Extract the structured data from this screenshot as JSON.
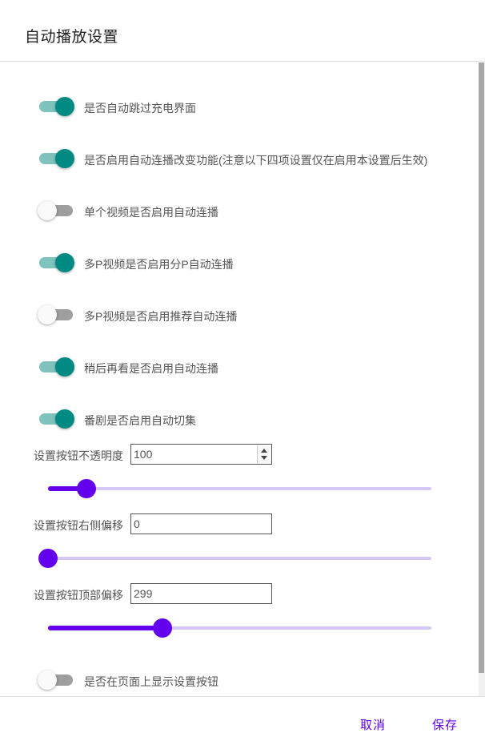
{
  "dialog": {
    "title": "自动播放设置",
    "accent_color": "#6200ee",
    "toggle_on_color": "#008a84"
  },
  "toggles": [
    {
      "label": "是否自动跳过充电界面",
      "on": true
    },
    {
      "label": "是否启用自动连播改变功能(注意以下四项设置仅在启用本设置后生效)",
      "on": true
    },
    {
      "label": "单个视频是否启用自动连播",
      "on": false
    },
    {
      "label": "多P视频是否启用分P自动连播",
      "on": true
    },
    {
      "label": "多P视频是否启用推荐自动连播",
      "on": false
    },
    {
      "label": "稍后再看是否启用自动连播",
      "on": true
    },
    {
      "label": "番剧是否启用自动切集",
      "on": true
    }
  ],
  "opacity": {
    "label": "设置按钮不透明度",
    "value": "100",
    "slider_fraction": 0.1
  },
  "right_offset": {
    "label": "设置按钮右侧偏移",
    "value": "0",
    "slider_fraction": 0.0
  },
  "top_offset": {
    "label": "设置按钮顶部偏移",
    "value": "299",
    "slider_fraction": 0.299
  },
  "show_button": {
    "label": "是否在页面上显示设置按钮",
    "on": false
  },
  "footer": {
    "cancel_label": "取消",
    "save_label": "保存"
  }
}
